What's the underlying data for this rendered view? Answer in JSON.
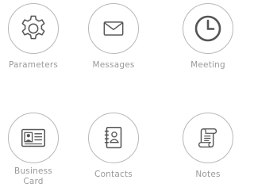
{
  "apps": [
    {
      "label": "Parameters",
      "icon": "gear-icon"
    },
    {
      "label": "Messages",
      "icon": "envelope-icon"
    },
    {
      "label": "Meeting",
      "icon": "clock-icon"
    },
    {
      "label": "Business\nCard",
      "icon": "id-card-icon"
    },
    {
      "label": "Contacts",
      "icon": "address-book-icon"
    },
    {
      "label": "Notes",
      "icon": "scroll-icon"
    }
  ],
  "colors": {
    "icon_stroke": "#555555",
    "circle_border": "#b8b8b8",
    "label_text": "#9a9a9a",
    "background": "#ffffff"
  }
}
